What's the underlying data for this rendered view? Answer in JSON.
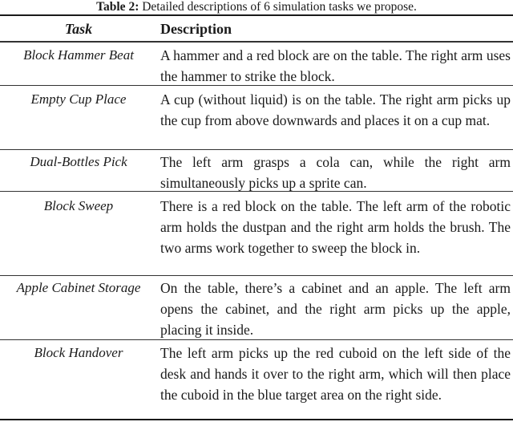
{
  "caption": {
    "label": "Table 2:",
    "text": " Detailed descriptions of 6 simulation tasks we propose."
  },
  "table": {
    "headers": {
      "task": "Task",
      "description": "Description"
    },
    "rows": [
      {
        "task": "Block Hammer Beat",
        "description": "A hammer and a red block are on the table. The right arm uses the hammer to strike the block."
      },
      {
        "task": "Empty Cup Place",
        "description": "A cup (without liquid) is on the table. The right arm picks up the cup from above downwards and places it on a cup mat."
      },
      {
        "task": "Dual-Bottles Pick",
        "description": "The left arm grasps a cola can, while the right arm simultaneously picks up a sprite can."
      },
      {
        "task": "Block Sweep",
        "description": "There is a red block on the table. The left arm of the robotic arm holds the dustpan and the right arm holds the brush. The two arms work together to sweep the block in."
      },
      {
        "task": "Apple Cabinet Storage",
        "description": "On the table, there’s a cabinet and an apple. The left arm opens the cabinet, and the right arm picks up the apple, placing it inside."
      },
      {
        "task": "Block Handover",
        "description": "The left arm picks up the red cuboid on the left side of the desk and hands it over to the right arm, which will then place the cuboid in the blue target area on the right side."
      }
    ]
  }
}
